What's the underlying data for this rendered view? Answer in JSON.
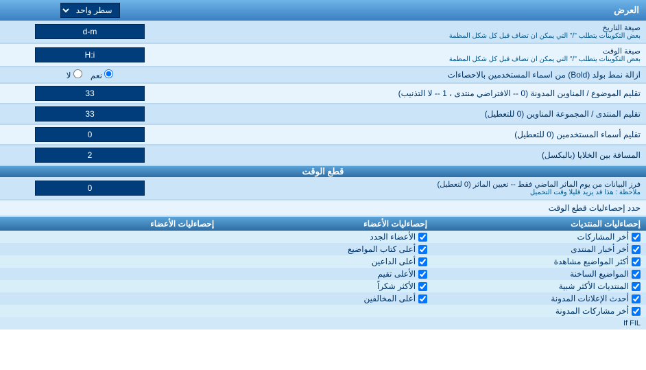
{
  "header": {
    "title": "العرض",
    "dropdown_label": "سطر واحد"
  },
  "rows": [
    {
      "label": "صيغة التاريخ\nبعض التكوينات يتطلب \"/\" التي يمكن ان تضاف قبل كل شكل المظمة",
      "value": "d-m"
    },
    {
      "label": "صيغة الوقت\nبعض التكوينات يتطلب \"/\" التي يمكن ان تضاف قبل كل شكل المظمة",
      "value": "H:i"
    }
  ],
  "bold_row": {
    "label": "ازالة نمط بولد (Bold) من اسماء المستخدمين بالاحصاءات",
    "radio_yes": "نعم",
    "radio_no": "لا"
  },
  "topics_row": {
    "label": "تقليم الموضوع / المناوين المدونة (0 -- الافتراضي منتدى ، 1 -- لا التذنيب)",
    "value": "33"
  },
  "forum_row": {
    "label": "تقليم المنتدى / المجموعة المناوين (0 للتعطيل)",
    "value": "33"
  },
  "users_row": {
    "label": "تقليم أسماء المستخدمين (0 للتعطيل)",
    "value": "0"
  },
  "space_row": {
    "label": "المسافة بين الخلايا (بالبكسل)",
    "value": "2"
  },
  "cutoff_section": {
    "title": "قطع الوقت"
  },
  "cutoff_row": {
    "label": "فرز البيانات من يوم الماثر الماضي فقط -- تعيين الماثر (0 لتعطيل)",
    "note": "ملاحظة : هذا قد يزيد قليلا وقت التحميل",
    "value": "0"
  },
  "stats_limit": {
    "label": "حدد إحصاءليات قطع الوقت"
  },
  "checkboxes": {
    "col1_header": "إحصاءليات المنتديات",
    "col2_header": "إحصاءليات الأعضاء",
    "col3_header": "",
    "col1_items": [
      "أخر المشاركات",
      "أخر أخبار المنتدى",
      "أكثر المواضيع مشاهدة",
      "المواضيع الساخنة",
      "المنتديات الأكثر شبية",
      "أحدث الإعلانات المدونة",
      "أخر مشاركات المدونة"
    ],
    "col2_items": [
      "الأعضاء الجدد",
      "أعلى كتاب المواضيع",
      "أعلى الداعين",
      "الأعلى تقيم",
      "الأكثر شكراً",
      "أعلى المخالفين"
    ],
    "col3_header_label": "إحصاءليات الأعضاء",
    "col3_items": []
  }
}
